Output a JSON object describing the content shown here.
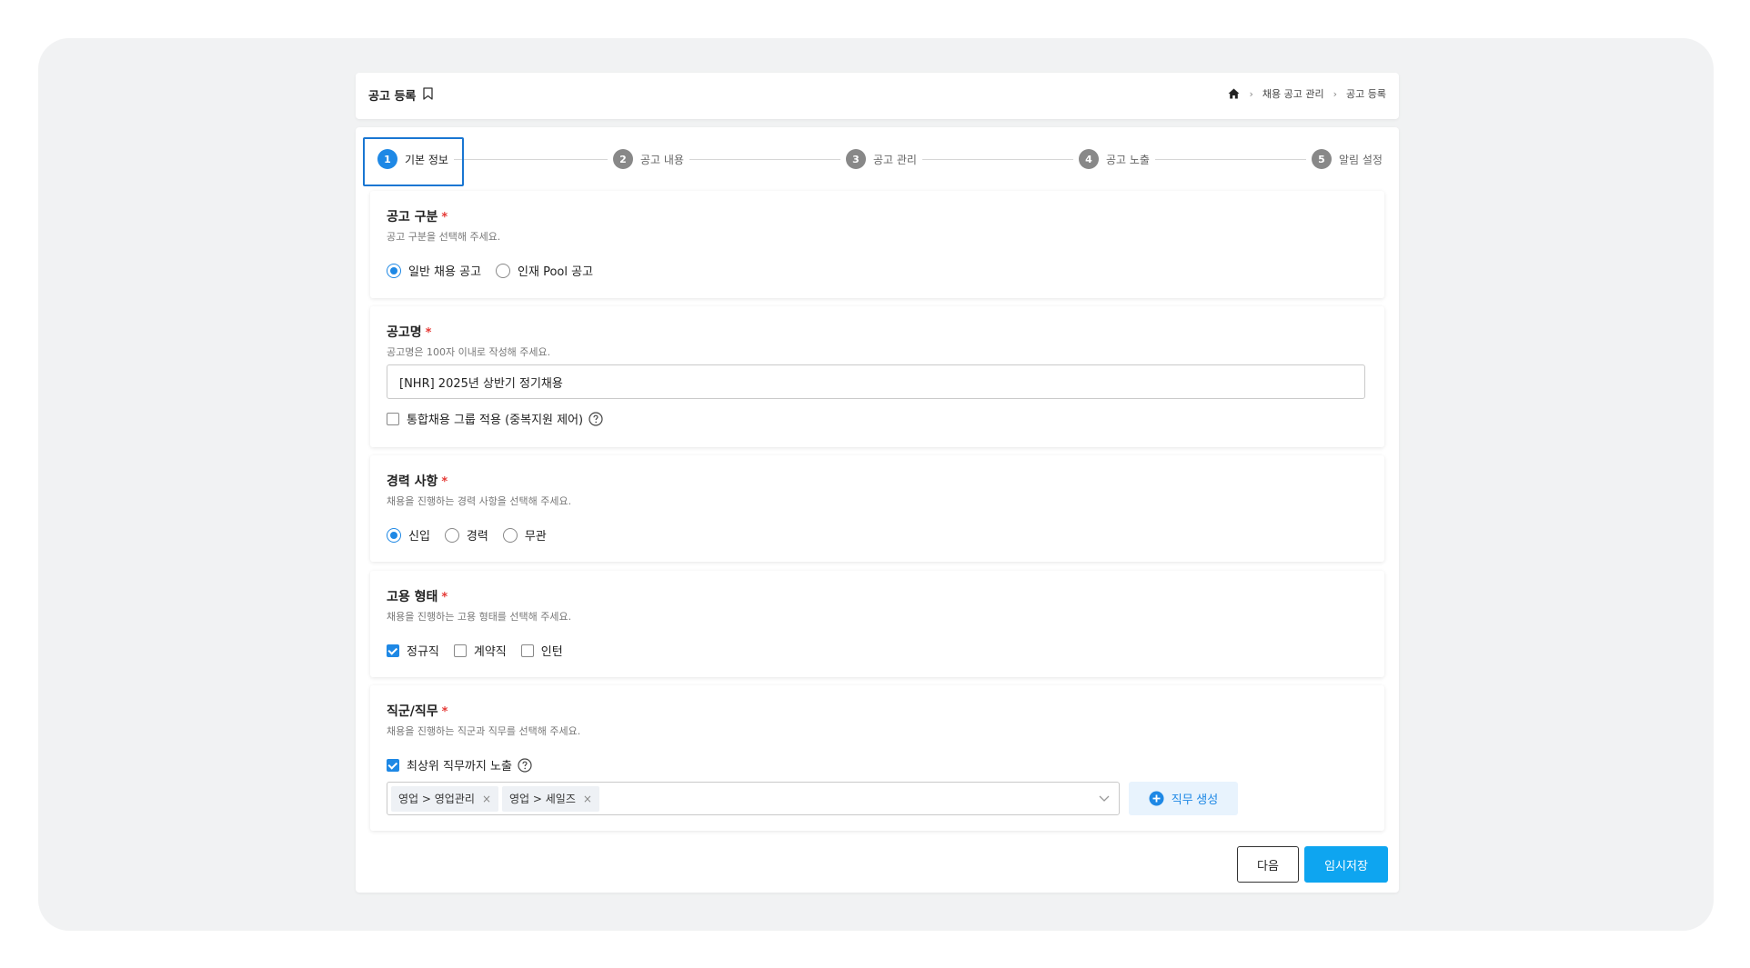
{
  "header": {
    "title": "공고 등록",
    "breadcrumb": [
      "채용 공고 관리",
      "공고 등록"
    ]
  },
  "stepper": {
    "steps": [
      {
        "num": "1",
        "label": "기본 정보",
        "active": true
      },
      {
        "num": "2",
        "label": "공고 내용",
        "active": false
      },
      {
        "num": "3",
        "label": "공고 관리",
        "active": false
      },
      {
        "num": "4",
        "label": "공고 노출",
        "active": false
      },
      {
        "num": "5",
        "label": "알림 설정",
        "active": false
      }
    ]
  },
  "sections": {
    "posting_type": {
      "title": "공고 구분",
      "required_mark": "*",
      "desc": "공고 구분을 선택해 주세요.",
      "options": [
        {
          "label": "일반 채용 공고",
          "selected": true
        },
        {
          "label": "인재 Pool 공고",
          "selected": false
        }
      ]
    },
    "posting_name": {
      "title": "공고명",
      "required_mark": "*",
      "desc": "공고명은 100자 이내로 작성해 주세요.",
      "value": "[NHR] 2025년 상반기 정기채용",
      "checkbox": {
        "label": "통합채용 그룹 적용 (중복지원 제어)",
        "checked": false
      }
    },
    "career": {
      "title": "경력 사항",
      "required_mark": "*",
      "desc": "채용을 진행하는 경력 사항을 선택해 주세요.",
      "options": [
        {
          "label": "신입",
          "selected": true
        },
        {
          "label": "경력",
          "selected": false
        },
        {
          "label": "무관",
          "selected": false
        }
      ]
    },
    "employment": {
      "title": "고용 형태",
      "required_mark": "*",
      "desc": "채용을 진행하는 고용 형태를 선택해 주세요.",
      "options": [
        {
          "label": "정규직",
          "checked": true
        },
        {
          "label": "계약직",
          "checked": false
        },
        {
          "label": "인턴",
          "checked": false
        }
      ]
    },
    "job": {
      "title": "직군/직무",
      "required_mark": "*",
      "desc": "채용을 진행하는 직군과 직무를 선택해 주세요.",
      "checkbox": {
        "label": "최상위 직무까지 노출",
        "checked": true
      },
      "tags": [
        "영업 > 영업관리",
        "영업 > 세일즈"
      ],
      "tag_remove": "×",
      "create_label": "직무 생성"
    }
  },
  "footer": {
    "next_label": "다음",
    "save_label": "임시저장"
  },
  "colors": {
    "accent": "#1e88e5",
    "primary_button": "#0ea5f0",
    "required": "#e53935"
  }
}
